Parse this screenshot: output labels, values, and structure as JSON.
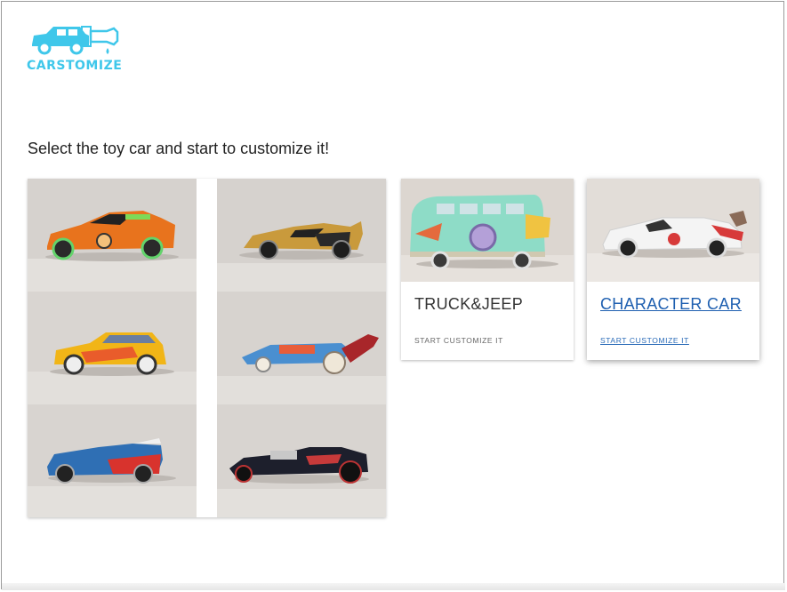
{
  "brand": {
    "name": "CARSTOMIZE",
    "logo_icon": "car-with-paint-brush-icon",
    "accent_color": "#3fc7ea"
  },
  "intro": {
    "text": "Select the toy car and start to customize it!"
  },
  "gallery": {
    "tiles": [
      {
        "icon": "orange-race-car-icon"
      },
      {
        "icon": "gold-supercar-icon"
      },
      {
        "icon": "yellow-hatchback-zooom-icon"
      },
      {
        "icon": "blue-dragster-icon"
      },
      {
        "icon": "blue-red-roadster-icon"
      },
      {
        "icon": "black-hot-rod-icon"
      }
    ]
  },
  "cards": [
    {
      "title": "TRUCK&JEEP",
      "cta": "START CUSTOMIZE IT",
      "photo_icon": "green-hippie-van-icon"
    },
    {
      "title": "CHARACTER CAR",
      "cta": "START CUSTOMIZE IT",
      "photo_icon": "white-le-mans-racer-icon"
    }
  ]
}
